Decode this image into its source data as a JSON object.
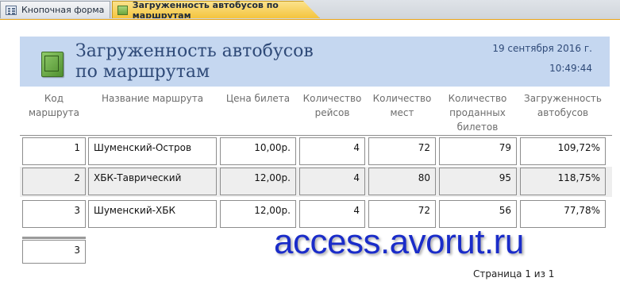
{
  "tabs": [
    {
      "label": "Кнопочная форма",
      "icon": "form-icon"
    },
    {
      "label": "Загруженность автобусов по маршрутам",
      "icon": "report-icon"
    }
  ],
  "report": {
    "title": "Загруженность автобусов по маршрутам",
    "date": "19 сентября 2016 г.",
    "time": "10:49:44"
  },
  "columns": [
    "Код маршрута",
    "Название маршрута",
    "Цена билета",
    "Количество рейсов",
    "Количество мест",
    "Количество проданных билетов",
    "Загруженность автобусов"
  ],
  "rows": [
    {
      "code": "1",
      "name": "Шуменский-Остров",
      "price": "10,00р.",
      "trips": "4",
      "seats": "72",
      "sold": "79",
      "load": "109,72%"
    },
    {
      "code": "2",
      "name": "ХБК-Таврический",
      "price": "12,00р.",
      "trips": "4",
      "seats": "80",
      "sold": "95",
      "load": "118,75%"
    },
    {
      "code": "3",
      "name": "Шуменский-ХБК",
      "price": "12,00р.",
      "trips": "4",
      "seats": "72",
      "sold": "56",
      "load": "77,78%"
    }
  ],
  "summary": {
    "count": "3"
  },
  "footer": {
    "page": "Страница 1 из 1"
  },
  "watermark": "access.avorut.ru",
  "colors": {
    "header_band": "#c5d7f0",
    "alt_row": "#eeeeee",
    "active_tab": "#f4c43d",
    "watermark": "#1a2cc9"
  }
}
